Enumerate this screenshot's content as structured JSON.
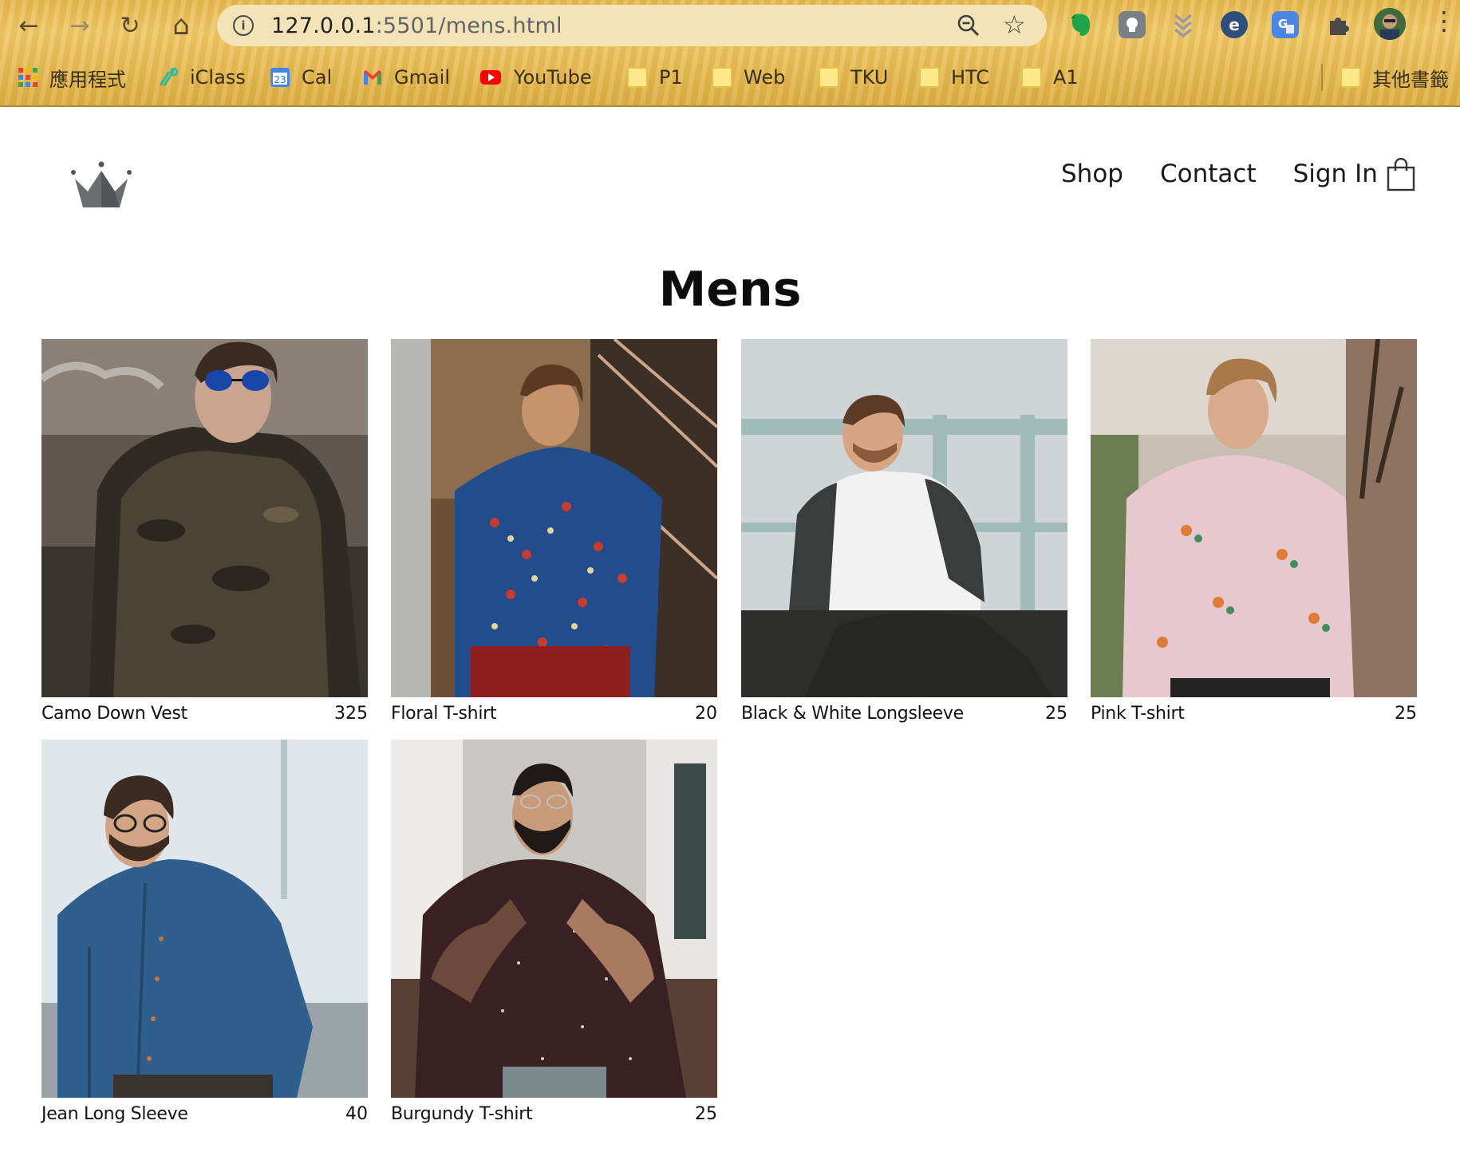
{
  "browser": {
    "url_host": "127.0.0.1",
    "url_rest": ":5501/mens.html",
    "info_glyph": "i",
    "back_glyph": "←",
    "forward_glyph": "→",
    "reload_glyph": "↻",
    "home_glyph": "⌂",
    "star_glyph": "☆",
    "menu_glyph": "⋮",
    "bookmarks": [
      {
        "label": "應用程式",
        "icon": "apps-grid-icon"
      },
      {
        "label": "iClass",
        "icon": "iclass-icon"
      },
      {
        "label": "Cal",
        "icon": "calendar-icon"
      },
      {
        "label": "Gmail",
        "icon": "gmail-icon"
      },
      {
        "label": "YouTube",
        "icon": "youtube-icon"
      },
      {
        "label": "P1",
        "icon": "folder-icon"
      },
      {
        "label": "Web",
        "icon": "folder-icon"
      },
      {
        "label": "TKU",
        "icon": "folder-icon"
      },
      {
        "label": "HTC",
        "icon": "folder-icon"
      },
      {
        "label": "A1",
        "icon": "folder-icon"
      },
      {
        "label": "其他書籤",
        "icon": "folder-icon"
      }
    ],
    "calendar_day": "23"
  },
  "site": {
    "nav": {
      "shop": "Shop",
      "contact": "Contact",
      "sign_in": "Sign In"
    },
    "logo_icon": "crown-icon",
    "cart_icon": "shopping-bag-icon",
    "page_title": "Mens"
  },
  "products": [
    {
      "name": "Camo Down Vest",
      "price": "325",
      "image": "man-camo-vest-photo",
      "bg": "#5a4f45"
    },
    {
      "name": "Floral T-shirt",
      "price": "20",
      "image": "man-floral-shirt-photo",
      "bg": "#6a4a2f"
    },
    {
      "name": "Black & White Longsleeve",
      "price": "25",
      "image": "man-raglan-longsleeve-photo",
      "bg": "#c9d0d2"
    },
    {
      "name": "Pink T-shirt",
      "price": "25",
      "image": "man-pink-shirt-photo",
      "bg": "#c9c3bb"
    },
    {
      "name": "Jean Long Sleeve",
      "price": "40",
      "image": "man-denim-shirt-photo",
      "bg": "#d9e3ea"
    },
    {
      "name": "Burgundy T-shirt",
      "price": "25",
      "image": "man-burgundy-shirt-photo",
      "bg": "#b9b6b3"
    }
  ]
}
